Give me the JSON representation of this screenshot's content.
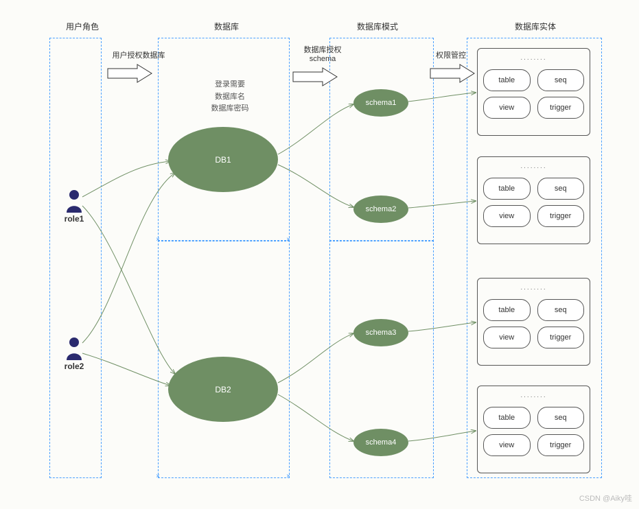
{
  "columns": {
    "user_roles": "用户角色",
    "database": "数据库",
    "schema": "数据库模式",
    "entity": "数据库实体"
  },
  "arrows": {
    "user_to_db": "用户授权数据库",
    "db_to_schema_line1": "数据库授权",
    "db_to_schema_line2": "schema",
    "schema_to_entity": "权限管控"
  },
  "login_info": {
    "line1": "登录需要",
    "line2": "数据库名",
    "line3": "数据库密码"
  },
  "roles": {
    "role1": "role1",
    "role2": "role2"
  },
  "databases": {
    "db1": "DB1",
    "db2": "DB2"
  },
  "schemas": {
    "s1": "schema1",
    "s2": "schema2",
    "s3": "schema3",
    "s4": "schema4"
  },
  "entity_box": {
    "dots": "........",
    "table": "table",
    "seq": "seq",
    "view": "view",
    "trigger": "trigger"
  },
  "watermark": "CSDN @Aiky哇"
}
